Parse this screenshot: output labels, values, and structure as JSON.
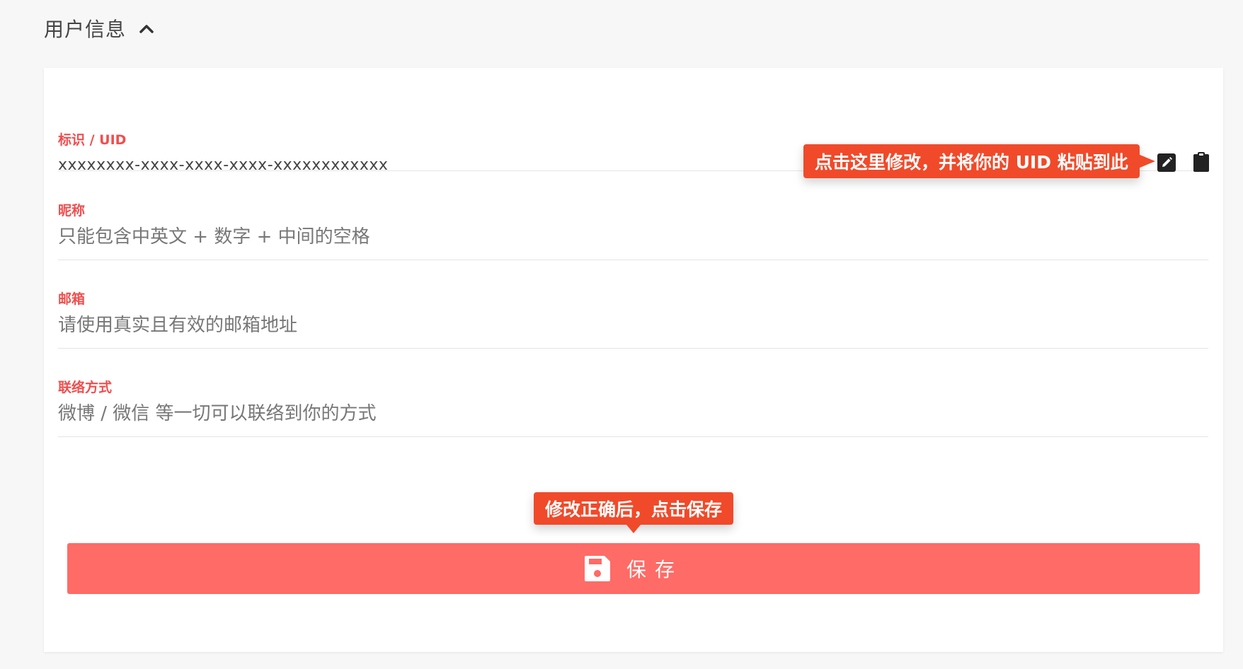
{
  "section": {
    "title": "用户信息",
    "toggle_icon": "chevron-up-icon"
  },
  "fields": {
    "uid": {
      "label": "标识 / UID",
      "value": "xxxxxxxx-xxxx-xxxx-xxxx-xxxxxxxxxxxx",
      "edit_icon": "pencil-icon",
      "copy_icon": "clipboard-icon"
    },
    "nickname": {
      "label": "昵称",
      "placeholder": "只能包含中英文 + 数字 + 中间的空格"
    },
    "email": {
      "label": "邮箱",
      "placeholder": "请使用真实且有效的邮箱地址"
    },
    "contact": {
      "label": "联络方式",
      "placeholder": "微博 / 微信 等一切可以联络到你的方式"
    }
  },
  "tooltips": {
    "uid_hint": "点击这里修改，并将你的 UID 粘贴到此",
    "save_hint": "修改正确后，点击保存"
  },
  "save_button": {
    "label": "保存",
    "icon": "floppy-disk-icon"
  },
  "colors": {
    "accent_label": "#f04e4e",
    "tooltip": "#f04a2a",
    "save_button": "#ff6b66"
  }
}
